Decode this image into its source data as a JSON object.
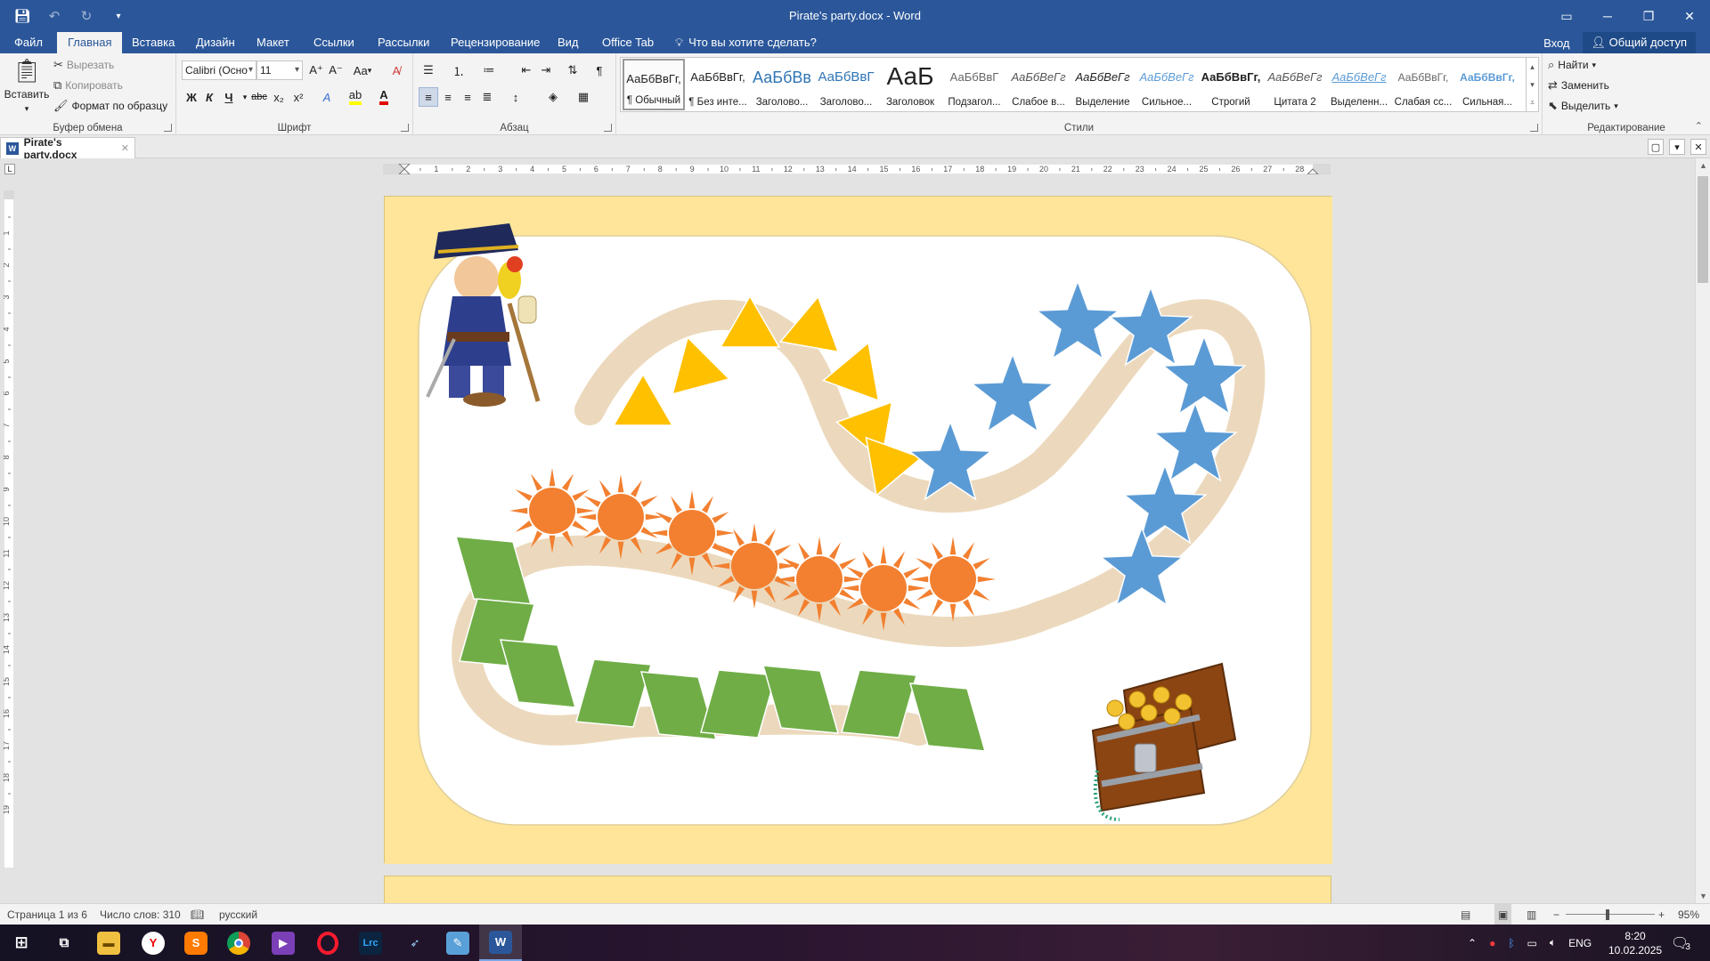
{
  "window": {
    "title": "Pirate's party.docx - Word",
    "qat": {
      "save": "save-icon",
      "undo": "undo-icon",
      "redo": "redo-icon",
      "customize": "customize-icon"
    },
    "controls": {
      "ribbon_display": "ribbon-display-icon",
      "minimize": "minimize-icon",
      "restore": "restore-icon",
      "close": "close-icon"
    }
  },
  "tabs": [
    {
      "label": "Файл",
      "active": false
    },
    {
      "label": "Главная",
      "active": true
    },
    {
      "label": "Вставка",
      "active": false
    },
    {
      "label": "Дизайн",
      "active": false
    },
    {
      "label": "Макет",
      "active": false
    },
    {
      "label": "Ссылки",
      "active": false
    },
    {
      "label": "Рассылки",
      "active": false
    },
    {
      "label": "Рецензирование",
      "active": false
    },
    {
      "label": "Вид",
      "active": false
    },
    {
      "label": "Office Tab",
      "active": false
    }
  ],
  "tellme": "Что вы хотите сделать?",
  "signin": "Вход",
  "share": "Общий доступ",
  "ribbon": {
    "clipboard": {
      "label": "Буфер обмена",
      "paste": "Вставить",
      "cut": "Вырезать",
      "copy": "Копировать",
      "format_painter": "Формат по образцу"
    },
    "font": {
      "label": "Шрифт",
      "name": "Calibri (Осно",
      "size": "11",
      "bold": "Ж",
      "italic": "К",
      "underline": "Ч",
      "strike": "abc",
      "subscript": "x₂",
      "superscript": "x²",
      "case": "Aa"
    },
    "paragraph": {
      "label": "Абзац"
    },
    "styles": {
      "label": "Стили",
      "items": [
        {
          "preview": "АаБбВвГг,",
          "name": "¶ Обычный",
          "selected": true
        },
        {
          "preview": "АаБбВвГг,",
          "name": "¶ Без инте...",
          "selected": false
        },
        {
          "preview": "АаБбВв",
          "name": "Заголово...",
          "selected": false
        },
        {
          "preview": "АаБбВвГ",
          "name": "Заголово...",
          "selected": false
        },
        {
          "preview": "АаБ",
          "name": "Заголовок",
          "selected": false
        },
        {
          "preview": "АаБбВвГ",
          "name": "Подзагол...",
          "selected": false
        },
        {
          "preview": "АаБбВеГг",
          "name": "Слабое в...",
          "selected": false
        },
        {
          "preview": "АаБбВеГг",
          "name": "Выделение",
          "selected": false
        },
        {
          "preview": "АаБбВеГг",
          "name": "Сильное...",
          "selected": false
        },
        {
          "preview": "АаБбВвГг,",
          "name": "Строгий",
          "selected": false
        },
        {
          "preview": "АаБбВеГг",
          "name": "Цитата 2",
          "selected": false
        },
        {
          "preview": "АаБбВеГг",
          "name": "Выделенн...",
          "selected": false
        },
        {
          "preview": "АаБбВвГг,",
          "name": "Слабая сс...",
          "selected": false
        },
        {
          "preview": "АаБбВвГг,",
          "name": "Сильная...",
          "selected": false
        }
      ]
    },
    "editing": {
      "label": "Редактирование",
      "find": "Найти",
      "replace": "Заменить",
      "select": "Выделить"
    }
  },
  "doc_tab": {
    "name": "Pirate's party.docx"
  },
  "ruler": {
    "numbers": [
      "1",
      "2",
      "3",
      "4",
      "5",
      "6",
      "7",
      "8",
      "9",
      "10",
      "11",
      "12",
      "13",
      "14",
      "15",
      "16",
      "17",
      "18",
      "19",
      "20",
      "21",
      "22",
      "23",
      "24",
      "25",
      "26",
      "27",
      "28"
    ]
  },
  "vruler": {
    "numbers": [
      "1",
      "2",
      "3",
      "4",
      "5",
      "6",
      "7",
      "8",
      "9",
      "10",
      "11",
      "12",
      "13",
      "14",
      "15",
      "16",
      "17",
      "18",
      "19"
    ]
  },
  "status": {
    "page": "Страница 1 из 6",
    "words": "Число слов: 310",
    "language": "русский",
    "zoom": "95%",
    "zoom_level": 0.47
  },
  "taskbar": {
    "apps": [
      "windows-start-icon",
      "task-view-icon",
      "file-explorer-icon",
      "yandex-browser-icon",
      "sublime-icon",
      "chrome-icon",
      "visual-studio-icon",
      "opera-icon",
      "lightroom-icon",
      "app-icon",
      "notepad-icon",
      "word-icon"
    ],
    "lang": "ENG",
    "time": "8:20",
    "date": "10.02.2025",
    "notifications": "3"
  },
  "colors": {
    "title_blue": "#2b579a",
    "page_yellow": "#ffe59a",
    "triangle": "#ffc000",
    "star": "#5b9bd5",
    "sun": "#f28030",
    "diamond": "#70ad47",
    "path": "#ecd9bd"
  }
}
